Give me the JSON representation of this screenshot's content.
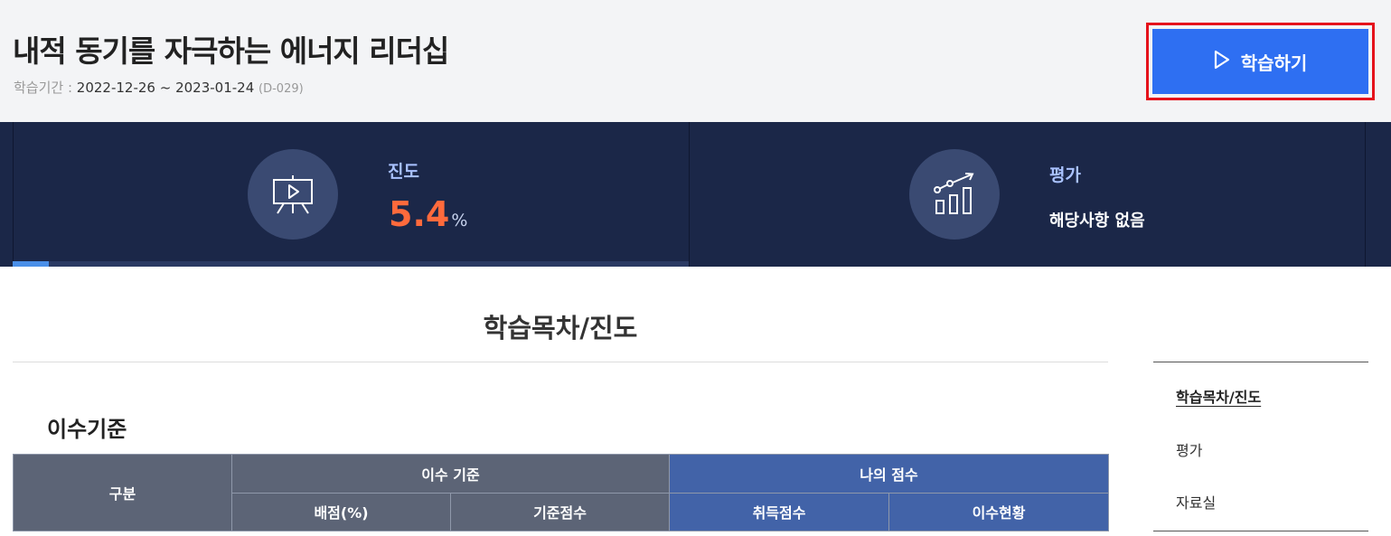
{
  "header": {
    "course_title": "내적 동기를 자극하는 에너지 리더십",
    "period_label": "학습기간 : ",
    "period_value": "2022-12-26 ~ 2023-01-24",
    "dday": "(D-029)",
    "study_button_label": "학습하기"
  },
  "stats": {
    "progress": {
      "label": "진도",
      "value": "5.4",
      "unit": "%",
      "fraction": 0.054
    },
    "evaluation": {
      "label": "평가",
      "text": "해당사항 없음"
    }
  },
  "main": {
    "section_title": "학습목차/진도",
    "criteria_title": "이수기준",
    "table": {
      "col_category": "구분",
      "group_criteria": "이수 기준",
      "group_my_score": "나의 점수",
      "col_allocation": "배점(%)",
      "col_base_score": "기준점수",
      "col_earned": "취득점수",
      "col_status": "이수현황"
    }
  },
  "side_nav": {
    "items": [
      {
        "label": "학습목차/진도",
        "active": true
      },
      {
        "label": "평가",
        "active": false
      },
      {
        "label": "자료실",
        "active": false
      }
    ]
  },
  "colors": {
    "header_bg": "#f3f4f6",
    "stats_bg": "#1b2748",
    "accent_blue": "#2e6ff2",
    "progress_value": "#ff6a3c",
    "highlight_border": "#e5121b",
    "table_gray": "#5c6476",
    "table_blue": "#4263a8"
  }
}
